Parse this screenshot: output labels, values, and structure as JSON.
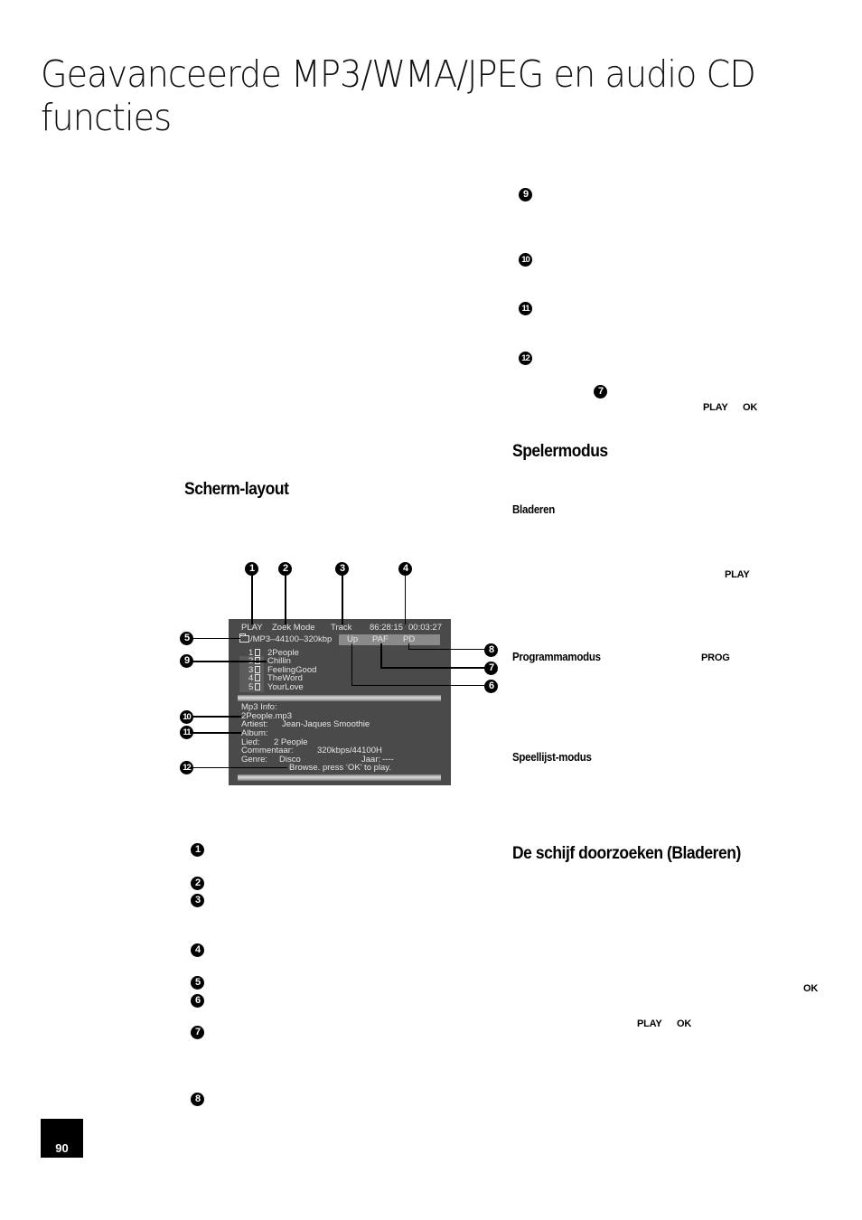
{
  "page": {
    "title": "Geavanceerde MP3/WMA/JPEG en audio CD functies",
    "page_number": "90"
  },
  "left_column": {
    "section_heading": "Scherm-layout",
    "legend_markers": [
      "1",
      "2",
      "3",
      "4",
      "5",
      "6",
      "7",
      "8"
    ]
  },
  "screen_diagram": {
    "status_row": {
      "mode": "PLAY",
      "search_mode": "Zoek Mode",
      "track_label": "Track",
      "total_time": "86:28:15",
      "elapsed_time": "00:03:27"
    },
    "folder_path": "/MP3–44100–320kbp",
    "nav_buttons": [
      "Up",
      "PAF",
      "PD"
    ],
    "tracks": [
      {
        "number": "1",
        "name": "2People"
      },
      {
        "number": "2",
        "name": "Chillin"
      },
      {
        "number": "3",
        "name": "FeelingGood"
      },
      {
        "number": "4",
        "name": "TheWord"
      },
      {
        "number": "5",
        "name": "YourLove"
      }
    ],
    "info": {
      "header": "Mp3 Info:",
      "filename": "2People.mp3",
      "artist_label": "Artiest:",
      "artist_value": "Jean-Jaques Smoothie",
      "album_label": "Album:",
      "song_label": "Lied:",
      "song_value": "2 People",
      "comment_label": "Commentaar:",
      "comment_value": "320kbps/44100H",
      "genre_label": "Genre:",
      "genre_value": "Disco",
      "year_label": "Jaar:",
      "year_value": "----",
      "hint": "Browse. press ‘OK’ to play."
    },
    "callouts": [
      "1",
      "2",
      "3",
      "4",
      "5",
      "6",
      "7",
      "8",
      "9",
      "10",
      "11",
      "12"
    ]
  },
  "right_column": {
    "legend_markers": [
      "9",
      "10",
      "11",
      "12"
    ],
    "inline_marker": "7",
    "keys_row1": [
      "PLAY",
      "OK"
    ],
    "section_player_mode": "Spelermodus",
    "sub_browse": "Bladeren",
    "key_play": "PLAY",
    "sub_program": "Programmamodus",
    "key_prog": "PROG",
    "sub_playlist": "Speellijst-modus",
    "section_search": "De schijf doorzoeken (Bladeren)",
    "key_ok": "OK",
    "keys_row2": [
      "PLAY",
      "OK"
    ]
  }
}
